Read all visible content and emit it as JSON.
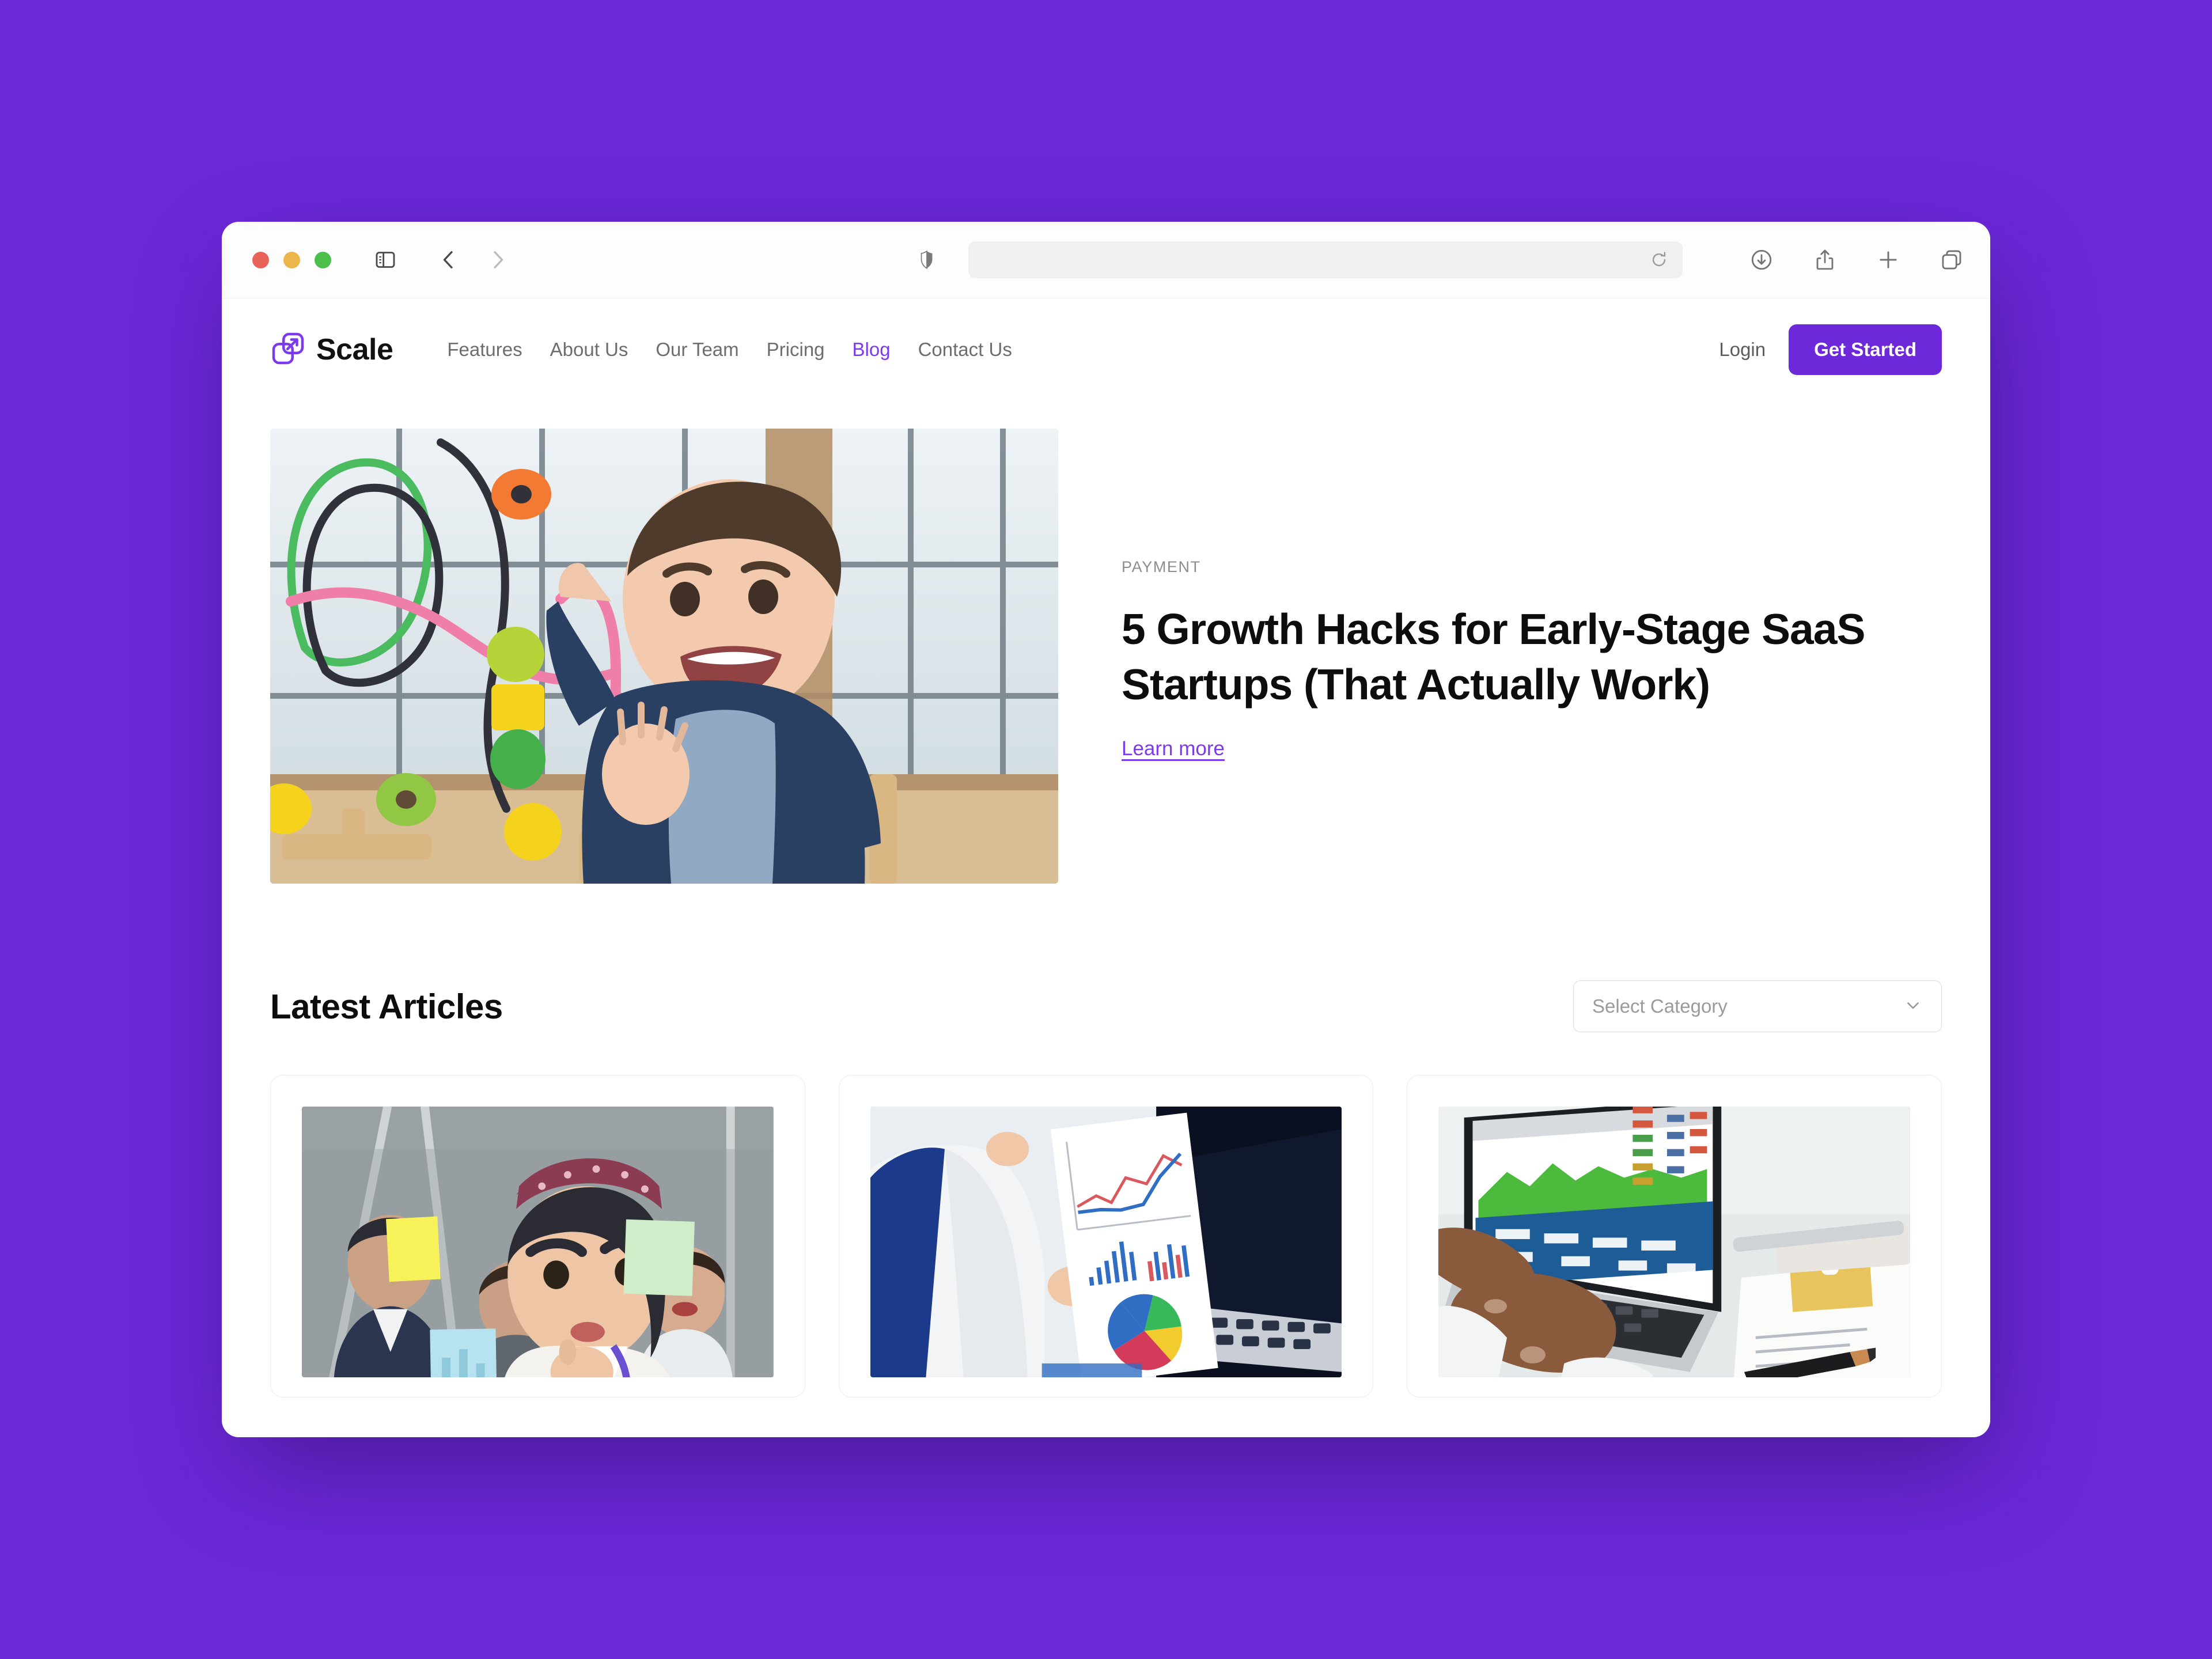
{
  "browser": {
    "traffic_lights": [
      "close",
      "minimize",
      "maximize"
    ],
    "address_value": "",
    "address_placeholder": "",
    "icons": {
      "sidebar": "sidebar-toggle-icon",
      "back": "chevron-left-icon",
      "forward": "chevron-right-icon",
      "shield": "privacy-shield-icon",
      "reload": "reload-icon",
      "downloads": "downloads-icon",
      "share": "share-icon",
      "new_tab": "plus-icon",
      "tab_overview": "tab-overview-icon"
    }
  },
  "site": {
    "brand": {
      "name": "Scale",
      "logo_icon": "scale-logo-icon",
      "color": "#7C3AED"
    },
    "nav": [
      {
        "label": "Features",
        "active": false
      },
      {
        "label": "About Us",
        "active": false
      },
      {
        "label": "Our Team",
        "active": false
      },
      {
        "label": "Pricing",
        "active": false
      },
      {
        "label": "Blog",
        "active": true
      },
      {
        "label": "Contact Us",
        "active": false
      }
    ],
    "login_label": "Login",
    "cta_label": "Get Started",
    "accent_color": "#6D28D9",
    "page_background": "#6A28D7"
  },
  "hero": {
    "category": "PAYMENT",
    "title": "5 Growth Hacks for Early-Stage SaaS Startups (That Actually Work)",
    "link_label": "Learn more",
    "image_alt": "Smiling toddler playing with a colorful wooden bead maze toy in front of large windows"
  },
  "latest": {
    "heading": "Latest Articles",
    "filter_placeholder": "Select Category",
    "filter_icon": "chevron-down-icon",
    "cards": [
      {
        "image_alt": "Team brainstorming session with colorful sticky notes on a glass board"
      },
      {
        "image_alt": "Person holding a printed report with line charts, bar charts and a pie chart beside a laptop"
      },
      {
        "image_alt": "Hands typing on a laptop showing a spreadsheet dashboard next to an invoice clipboard and pen"
      }
    ]
  }
}
